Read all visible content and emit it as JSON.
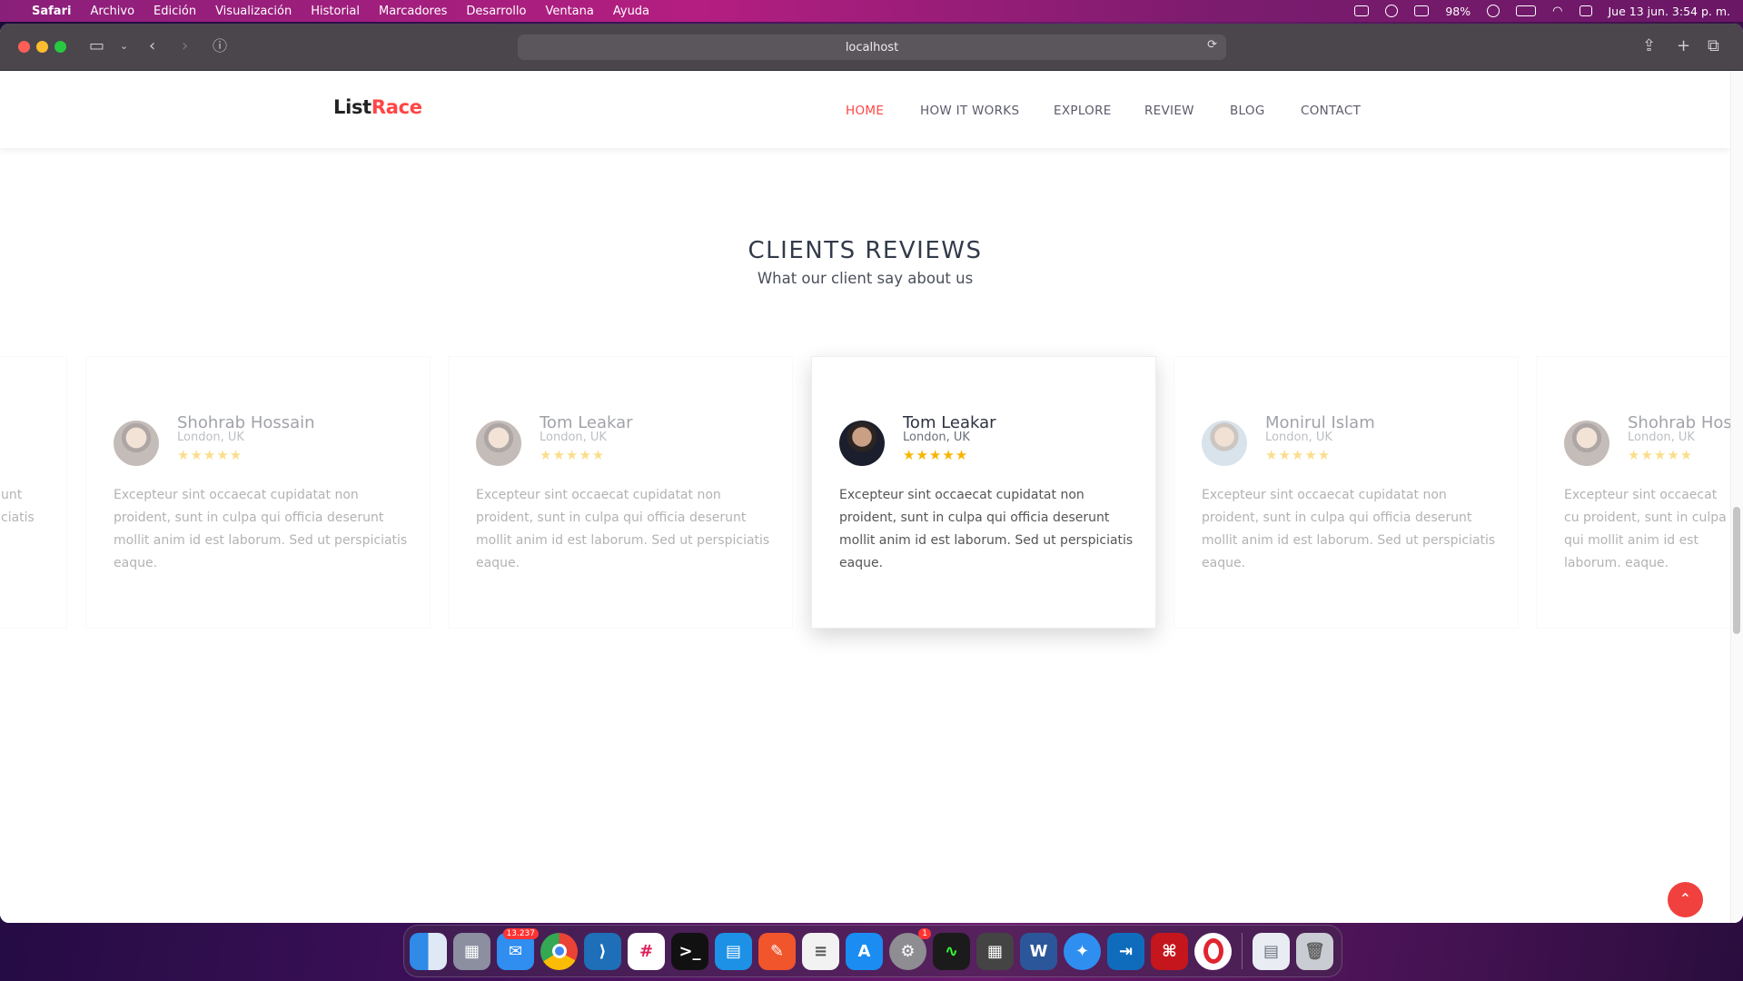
{
  "menubar": {
    "apple": "",
    "app": "Safari",
    "items": [
      "Archivo",
      "Edición",
      "Visualización",
      "Historial",
      "Marcadores",
      "Desarrollo",
      "Ventana",
      "Ayuda"
    ],
    "battery": "98%",
    "datetime": "Jue 13 jun.  3:54 p. m."
  },
  "browser": {
    "url": "localhost"
  },
  "site": {
    "logo_a": "List",
    "logo_b": "Race",
    "nav": [
      "HOME",
      "HOW IT WORKS",
      "EXPLORE",
      "REVIEW",
      "BLOG",
      "CONTACT"
    ],
    "active_nav": "HOME",
    "section_title": "CLIENTS REVIEWS",
    "section_subtitle": "What our client say about us",
    "reviews": [
      {
        "name": "Shohrab Hossain",
        "location": "London, UK",
        "stars": "★★★★★",
        "text": "Excepteur sint occaecat cupidatat non proident, sunt in culpa qui officia deserunt mollit anim id est laborum. Sed ut perspiciatis eaque."
      },
      {
        "name": "Tom Leakar",
        "location": "London, UK",
        "stars": "★★★★★",
        "text": "Excepteur sint occaecat cupidatat non proident, sunt in culpa qui officia deserunt mollit anim id est laborum. Sed ut perspiciatis eaque."
      },
      {
        "name": "Tom Leakar",
        "location": "London, UK",
        "stars": "★★★★★",
        "text": "Excepteur sint occaecat cupidatat non proident, sunt in culpa qui officia deserunt mollit anim id est laborum. Sed ut perspiciatis eaque."
      },
      {
        "name": "Monirul Islam",
        "location": "London, UK",
        "stars": "★★★★★",
        "text": "Excepteur sint occaecat cupidatat non proident, sunt in culpa qui officia deserunt mollit anim id est laborum. Sed ut perspiciatis eaque."
      },
      {
        "name": "Shohrab Hos",
        "location": "London, UK",
        "stars": "★★★★★",
        "text": "Excepteur sint occaecat cu proident, sunt in culpa qui mollit anim id est laborum. eaque."
      }
    ],
    "partial_left_text": "unt\nciatis",
    "back_to_top_icon": "chevron-up-icon"
  },
  "dock": {
    "mail_badge": "13.237",
    "settings_badge": "1",
    "apps": [
      "finder",
      "launchpad",
      "mail",
      "chrome",
      "vscode",
      "slack",
      "terminal",
      "docker",
      "sketch",
      "textedit",
      "app-store",
      "system-settings",
      "activity-monitor",
      "calculator",
      "word",
      "safari",
      "remote",
      "acrobat",
      "opera",
      "documents",
      "trash"
    ]
  }
}
